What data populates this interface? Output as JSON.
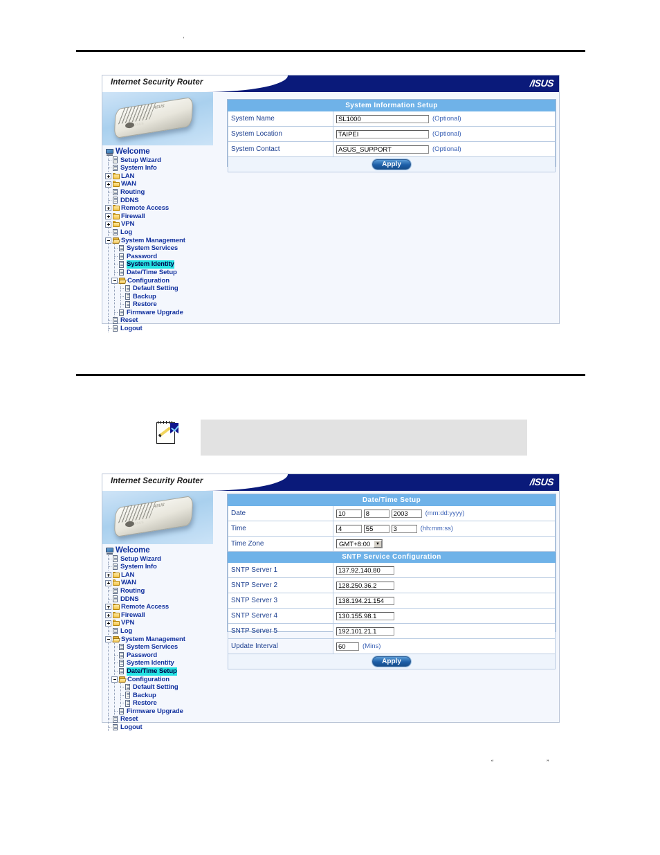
{
  "page": {
    "top_mark": "'",
    "bottom_left_quote": "“",
    "bottom_right_quote": "”"
  },
  "brand": {
    "product_title": "Internet Security Router",
    "logo_text": "/ISUS",
    "router_badge": "ASUS",
    "router_badge_front": "ASUS"
  },
  "nav": {
    "root_label": "Welcome",
    "items": [
      {
        "label": "Setup Wizard",
        "level": 1,
        "icon": "page-icon",
        "expander": "none",
        "selected": false
      },
      {
        "label": "System Info",
        "level": 1,
        "icon": "page-icon",
        "expander": "none",
        "selected": false
      },
      {
        "label": "LAN",
        "level": 1,
        "icon": "folder-icon",
        "expander": "plus",
        "selected": false
      },
      {
        "label": "WAN",
        "level": 1,
        "icon": "folder-icon",
        "expander": "plus",
        "selected": false
      },
      {
        "label": "Routing",
        "level": 1,
        "icon": "page-icon",
        "expander": "none",
        "selected": false
      },
      {
        "label": "DDNS",
        "level": 1,
        "icon": "page-icon",
        "expander": "none",
        "selected": false
      },
      {
        "label": "Remote Access",
        "level": 1,
        "icon": "folder-icon",
        "expander": "plus",
        "selected": false
      },
      {
        "label": "Firewall",
        "level": 1,
        "icon": "folder-icon",
        "expander": "plus",
        "selected": false
      },
      {
        "label": "VPN",
        "level": 1,
        "icon": "folder-icon",
        "expander": "plus",
        "selected": false
      },
      {
        "label": "Log",
        "level": 1,
        "icon": "page-icon",
        "expander": "none",
        "selected": false
      },
      {
        "label": "System Management",
        "level": 1,
        "icon": "folder-open-icon",
        "expander": "minus",
        "selected": false
      },
      {
        "label": "System Services",
        "level": 2,
        "icon": "page-icon",
        "expander": "none",
        "selected": false
      },
      {
        "label": "Password",
        "level": 2,
        "icon": "page-icon",
        "expander": "none",
        "selected": false
      },
      {
        "label": "System Identity",
        "level": 2,
        "icon": "page-icon",
        "expander": "none",
        "selected": false
      },
      {
        "label": "Date/Time Setup",
        "level": 2,
        "icon": "page-icon",
        "expander": "none",
        "selected": false
      },
      {
        "label": "Configuration",
        "level": 2,
        "icon": "folder-open-icon",
        "expander": "minus",
        "selected": false
      },
      {
        "label": "Default Setting",
        "level": 3,
        "icon": "page-icon",
        "expander": "none",
        "selected": false
      },
      {
        "label": "Backup",
        "level": 3,
        "icon": "page-icon",
        "expander": "none",
        "selected": false
      },
      {
        "label": "Restore",
        "level": 3,
        "icon": "page-icon",
        "expander": "none",
        "selected": false
      },
      {
        "label": "Firmware Upgrade",
        "level": 2,
        "icon": "page-icon",
        "expander": "none",
        "selected": false
      },
      {
        "label": "Reset",
        "level": 1,
        "icon": "page-icon",
        "expander": "none",
        "selected": false
      },
      {
        "label": "Logout",
        "level": 1,
        "icon": "page-icon",
        "expander": "none",
        "selected": false
      }
    ],
    "selected_screen1": "System Identity",
    "selected_screen2": "Date/Time Setup"
  },
  "screen1": {
    "section_title": "System Information Setup",
    "rows": [
      {
        "label": "System Name",
        "value": "SL1000",
        "hint": "(Optional)"
      },
      {
        "label": "System Location",
        "value": "TAIPEI",
        "hint": "(Optional)"
      },
      {
        "label": "System Contact",
        "value": "ASUS_SUPPORT",
        "hint": "(Optional)"
      }
    ],
    "apply_label": "Apply"
  },
  "screen2": {
    "section_title": "Date/Time Setup",
    "date": {
      "label": "Date",
      "month": "10",
      "day": "8",
      "year": "2003",
      "hint": "(mm:dd:yyyy)"
    },
    "time": {
      "label": "Time",
      "hour": "4",
      "minute": "55",
      "second": "3",
      "hint": "(hh:mm:ss)"
    },
    "timezone": {
      "label": "Time Zone",
      "value": "GMT+8:00"
    },
    "sntp_section_title": "SNTP Service Configuration",
    "sntp_servers": [
      {
        "label": "SNTP Server 1",
        "value": "137.92.140.80"
      },
      {
        "label": "SNTP Server 2",
        "value": "128.250.36.2"
      },
      {
        "label": "SNTP Server 3",
        "value": "138.194.21.154"
      },
      {
        "label": "SNTP Server 4",
        "value": "130.155.98.1"
      },
      {
        "label": "SNTP Server 5",
        "value": "192.101.21.1"
      }
    ],
    "update_interval": {
      "label": "Update Interval",
      "value": "60",
      "hint": "(Mins)"
    },
    "apply_label": "Apply"
  },
  "colors": {
    "header_navy": "#0a1a7a",
    "section_blue": "#6fb2e8",
    "highlight_cyan": "#25e3e3",
    "link_blue": "#12319e"
  }
}
